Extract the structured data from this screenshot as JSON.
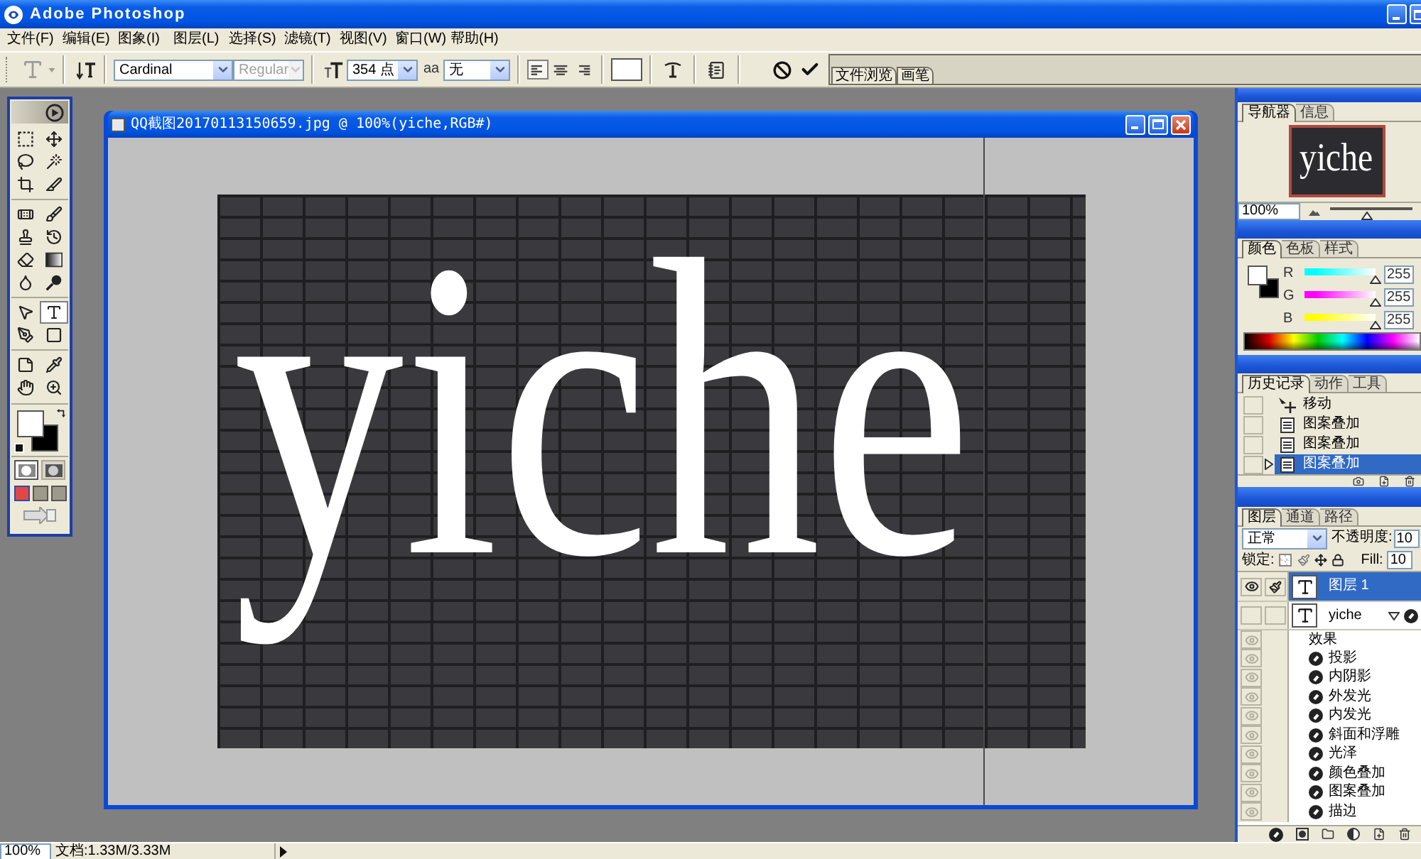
{
  "window": {
    "title": "Adobe Photoshop"
  },
  "menu": [
    "文件(F)",
    "编辑(E)",
    "图象(I)",
    "图层(L)",
    "选择(S)",
    "滤镜(T)",
    "视图(V)",
    "窗口(W)",
    "帮助(H)"
  ],
  "options_bar": {
    "font_family": "Cardinal",
    "font_style": {
      "value": "Regular",
      "disabled": true
    },
    "font_size": "354 点",
    "antialias_symbol": "aa",
    "antialias": "无",
    "align": [
      {
        "kind": "left",
        "selected": true
      },
      {
        "kind": "center",
        "selected": false
      },
      {
        "kind": "right",
        "selected": false
      }
    ],
    "palette_well": [
      "文件浏览",
      "画笔"
    ]
  },
  "toolbox": {
    "tools": [
      {
        "kind": "marquee",
        "selected": false
      },
      {
        "kind": "move",
        "selected": false
      },
      {
        "kind": "lasso",
        "selected": false
      },
      {
        "kind": "magic_wand",
        "selected": false
      },
      {
        "kind": "crop",
        "selected": false
      },
      {
        "kind": "slice",
        "selected": false
      },
      {
        "kind": "healing",
        "selected": false
      },
      {
        "kind": "brush",
        "selected": false
      },
      {
        "kind": "stamp",
        "selected": false
      },
      {
        "kind": "history_brush",
        "selected": false
      },
      {
        "kind": "eraser",
        "selected": false
      },
      {
        "kind": "gradient",
        "selected": false
      },
      {
        "kind": "blur",
        "selected": false
      },
      {
        "kind": "dodge",
        "selected": false
      },
      {
        "kind": "path_select",
        "selected": false
      },
      {
        "kind": "type",
        "selected": true
      },
      {
        "kind": "pen",
        "selected": false
      },
      {
        "kind": "shape",
        "selected": false
      },
      {
        "kind": "notes",
        "selected": false
      },
      {
        "kind": "eyedropper",
        "selected": false
      },
      {
        "kind": "hand",
        "selected": false
      },
      {
        "kind": "zoom",
        "selected": false
      }
    ],
    "colors": [
      {
        "kind": "foreground",
        "color": "#ffffff"
      },
      {
        "kind": "background",
        "color": "#000000"
      }
    ],
    "mask_modes": [
      {
        "selected": true
      },
      {
        "selected": false
      }
    ],
    "screen_modes": [
      {
        "selected": true
      },
      {
        "selected": false
      },
      {
        "selected": false
      }
    ]
  },
  "document": {
    "title": "QQ截图20170113150659.jpg @ 100%(yiche,RGB#)",
    "canvas_text": "yiche"
  },
  "navigator": {
    "tabs": [
      {
        "label": "导航器",
        "selected": true
      },
      {
        "label": "信息",
        "selected": false
      }
    ],
    "preview_text": "yiche",
    "zoom": "100%",
    "zoom_slider": {
      "level": 0.45
    }
  },
  "color_panel": {
    "tabs": [
      {
        "label": "颜色",
        "selected": true
      },
      {
        "label": "色板",
        "selected": false
      },
      {
        "label": "样式",
        "selected": false
      }
    ],
    "swatches": [
      {
        "kind": "foreground",
        "color": "#ffffff"
      },
      {
        "kind": "background",
        "color": "#000000"
      }
    ],
    "channels": [
      {
        "label": "R",
        "color": "#00ffff",
        "level": 1,
        "value": "255"
      },
      {
        "label": "G",
        "color": "#ff00ff",
        "level": 1,
        "value": "255"
      },
      {
        "label": "B",
        "color": "#ffff00",
        "level": 1,
        "value": "255"
      }
    ]
  },
  "history_panel": {
    "tabs": [
      {
        "label": "历史记录",
        "selected": true
      },
      {
        "label": "动作",
        "selected": false
      },
      {
        "label": "工具",
        "selected": false
      }
    ],
    "items": [
      {
        "label": "移动",
        "kind": "move",
        "selected": false
      },
      {
        "label": "图案叠加",
        "kind": "layer_style",
        "selected": false
      },
      {
        "label": "图案叠加",
        "kind": "layer_style",
        "selected": false
      },
      {
        "label": "图案叠加",
        "kind": "layer_style",
        "selected": true
      }
    ]
  },
  "layers_panel": {
    "tabs": [
      {
        "label": "图层",
        "selected": true
      },
      {
        "label": "通道",
        "selected": false
      },
      {
        "label": "路径",
        "selected": false
      }
    ],
    "blend_mode": "正常",
    "opacity_label": "不透明度:",
    "opacity": "10",
    "lock_label": "锁定:",
    "fill_label": "Fill:",
    "fill": "10",
    "layers": [
      {
        "name": "图层 1",
        "kind": "text",
        "selected": true,
        "visible": true
      },
      {
        "name": "yiche",
        "kind": "text",
        "selected": false,
        "visible": false,
        "expanded": true,
        "effects_label": "效果",
        "effects": [
          {
            "name": "投影",
            "visible": true
          },
          {
            "name": "内阴影",
            "visible": true
          },
          {
            "name": "外发光",
            "visible": true
          },
          {
            "name": "内发光",
            "visible": true
          },
          {
            "name": "斜面和浮雕",
            "visible": true
          },
          {
            "name": "光泽",
            "visible": true
          },
          {
            "name": "颜色叠加",
            "visible": true
          },
          {
            "name": "图案叠加",
            "visible": true
          },
          {
            "name": "描边",
            "visible": true
          }
        ]
      }
    ]
  },
  "status_bar": {
    "zoom": "100%",
    "doc_size": "文档:1.33M/3.33M"
  }
}
